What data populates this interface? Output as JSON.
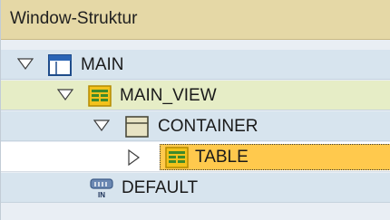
{
  "header": {
    "title": "Window-Struktur"
  },
  "tree": [
    {
      "label": "MAIN",
      "icon": "window-icon",
      "expanded": true
    },
    {
      "label": "MAIN_VIEW",
      "icon": "view-icon",
      "expanded": true
    },
    {
      "label": "CONTAINER",
      "icon": "container-icon",
      "expanded": true
    },
    {
      "label": "TABLE",
      "icon": "table-icon",
      "expanded": false,
      "selected": true
    },
    {
      "label": "DEFAULT",
      "icon": "inbound-plug-icon"
    }
  ],
  "colors": {
    "header_bg": "#e5d8a6",
    "row_bg": "#d7e4ee",
    "view_row_bg": "#e6edc6",
    "selection_bg": "#ffc94d"
  }
}
